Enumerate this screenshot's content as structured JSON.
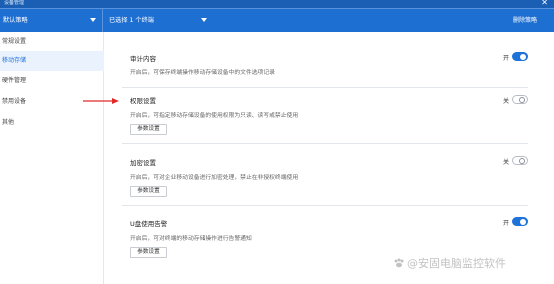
{
  "window": {
    "title": "设备管理",
    "close_glyph": "✕"
  },
  "toolbar": {
    "policy_select": "默认策略",
    "terminal_select": "已选择 1 个终端",
    "delete_label": "删除策略"
  },
  "sidebar": {
    "items": [
      {
        "label": "常规设置",
        "active": false
      },
      {
        "label": "移动存储",
        "active": true
      },
      {
        "label": "硬件管理",
        "active": false
      },
      {
        "label": "禁用设备",
        "active": false
      },
      {
        "label": "其他",
        "active": false
      }
    ]
  },
  "sections": [
    {
      "title": "审计内容",
      "description": "开启后，可保存终端操作移动存储设备中的文件选项记录",
      "toggle_label": "开",
      "toggle_on": true,
      "button": ""
    },
    {
      "title": "权限设置",
      "description": "开启后，可指定移动存储设备的使用权限为只读、读写或禁止使用",
      "toggle_label": "关",
      "toggle_on": false,
      "button": "参数设置"
    },
    {
      "title": "加密设置",
      "description": "开启后，可对企业移动设备进行加密处理，禁止在非授权终端使用",
      "toggle_label": "关",
      "toggle_on": false,
      "button": "参数设置"
    },
    {
      "title": "U盘使用告警",
      "description": "开启后，可对终端的移动存储操作进行告警通知",
      "toggle_label": "开",
      "toggle_on": true,
      "button": "参数设置"
    }
  ],
  "watermark": "@安固电脑监控软件",
  "colors": {
    "accent": "#1f72d8",
    "toolbar": "#1e6fd2",
    "arrow": "#e02a2a"
  }
}
